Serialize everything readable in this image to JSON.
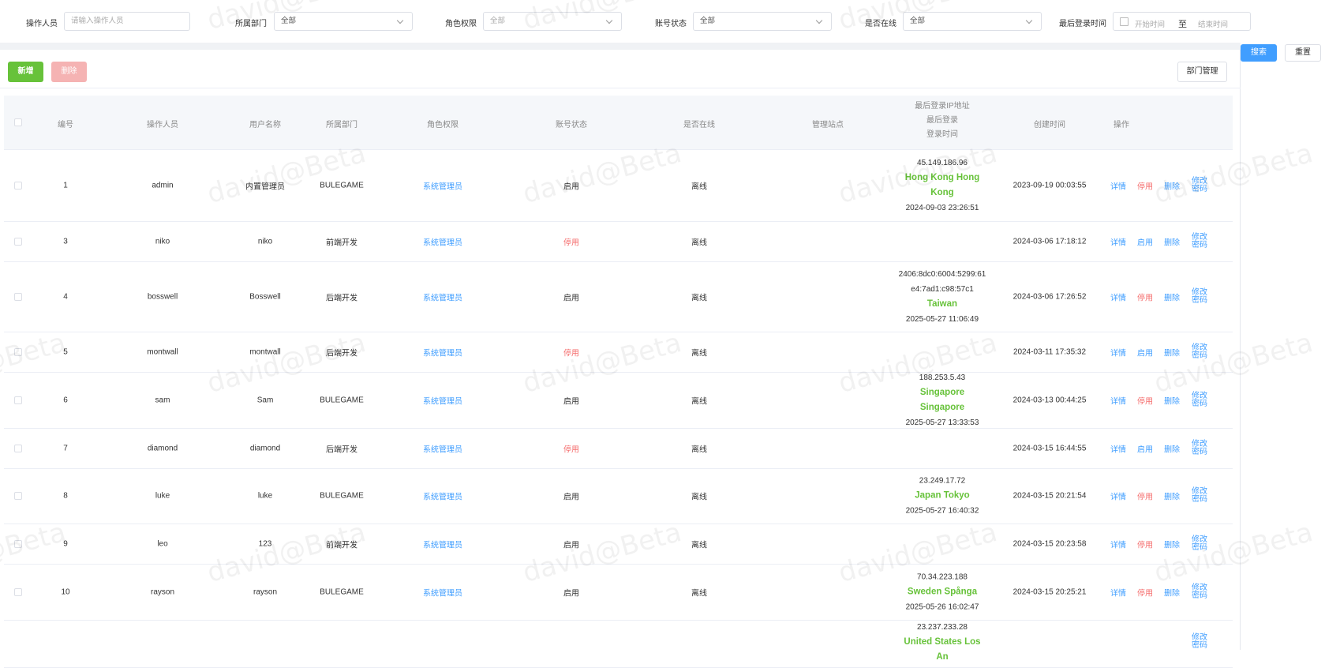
{
  "watermark": "david@Beta",
  "filters": {
    "operator": {
      "label": "操作人员",
      "placeholder": "请输入操作人员"
    },
    "department": {
      "label": "所属部门",
      "value": "全部"
    },
    "role": {
      "label": "角色权限",
      "value": "全部"
    },
    "status": {
      "label": "账号状态",
      "value": "全部"
    },
    "online": {
      "label": "是否在线",
      "value": "全部"
    },
    "last_login": {
      "label": "最后登录时间",
      "start_placeholder": "开始时间",
      "separator": "至",
      "end_placeholder": "结束时间"
    }
  },
  "buttons": {
    "search": "搜索",
    "reset": "重置",
    "add": "新增",
    "delete": "删除",
    "dept_manage": "部门管理"
  },
  "columns": {
    "id": "编号",
    "operator": "操作人员",
    "username": "用户名称",
    "department": "所属部门",
    "role": "角色权限",
    "status": "账号状态",
    "online": "是否在线",
    "site": "管理站点",
    "login_l1": "最后登录IP地址",
    "login_l2": "最后登录",
    "login_l3": "登录时间",
    "created": "创建时间",
    "actions": "操作"
  },
  "ops": {
    "detail": "详情",
    "stop": "停用",
    "start": "启用",
    "delete": "删除",
    "pwd": "修改密码"
  },
  "rows": [
    {
      "id": "1",
      "operator": "admin",
      "username": "内置管理员",
      "department": "BULEGAME",
      "role": "系统管理员",
      "status": "启用",
      "status_on": true,
      "online": "离线",
      "ip": "45.149.186.96",
      "location": "Hong Kong Hong Kong",
      "login_time": "2024-09-03 23:26:51",
      "created": "2023-09-19 00:03:55",
      "toggle": "停用"
    },
    {
      "id": "3",
      "operator": "niko",
      "username": "niko",
      "department": "前端开发",
      "role": "系统管理员",
      "status": "停用",
      "status_on": false,
      "online": "离线",
      "ip": "",
      "location": "",
      "login_time": "",
      "created": "2024-03-06 17:18:12",
      "toggle": "启用"
    },
    {
      "id": "4",
      "operator": "bosswell",
      "username": "Bosswell",
      "department": "后端开发",
      "role": "系统管理员",
      "status": "启用",
      "status_on": true,
      "online": "离线",
      "ip": "2406:8dc0:6004:5299:61e4:7ad1:c98:57c1",
      "ip_l1": "2406:8dc0:6004:5299:61",
      "ip_l2": "e4:7ad1:c98:57c1",
      "location": "Taiwan",
      "login_time": "2025-05-27 11:06:49",
      "created": "2024-03-06 17:26:52",
      "toggle": "停用"
    },
    {
      "id": "5",
      "operator": "montwall",
      "username": "montwall",
      "department": "后端开发",
      "role": "系统管理员",
      "status": "停用",
      "status_on": false,
      "online": "离线",
      "ip": "",
      "location": "",
      "login_time": "",
      "created": "2024-03-11 17:35:32",
      "toggle": "启用"
    },
    {
      "id": "6",
      "operator": "sam",
      "username": "Sam",
      "department": "BULEGAME",
      "role": "系统管理员",
      "status": "启用",
      "status_on": true,
      "online": "离线",
      "ip": "188.253.5.43",
      "location": "Singapore Singapore",
      "login_time": "2025-05-27 13:33:53",
      "created": "2024-03-13 00:44:25",
      "toggle": "停用"
    },
    {
      "id": "7",
      "operator": "diamond",
      "username": "diamond",
      "department": "后端开发",
      "role": "系统管理员",
      "status": "停用",
      "status_on": false,
      "online": "离线",
      "ip": "",
      "location": "",
      "login_time": "",
      "created": "2024-03-15 16:44:55",
      "toggle": "启用"
    },
    {
      "id": "8",
      "operator": "luke",
      "username": "luke",
      "department": "BULEGAME",
      "role": "系统管理员",
      "status": "启用",
      "status_on": true,
      "online": "离线",
      "ip": "23.249.17.72",
      "location": "Japan Tokyo",
      "login_time": "2025-05-27 16:40:32",
      "created": "2024-03-15 20:21:54",
      "toggle": "停用"
    },
    {
      "id": "9",
      "operator": "leo",
      "username": "123",
      "department": "前端开发",
      "role": "系统管理员",
      "status": "启用",
      "status_on": true,
      "online": "离线",
      "ip": "",
      "location": "",
      "login_time": "",
      "created": "2024-03-15 20:23:58",
      "toggle": "停用"
    },
    {
      "id": "10",
      "operator": "rayson",
      "username": "rayson",
      "department": "BULEGAME",
      "role": "系统管理员",
      "status": "启用",
      "status_on": true,
      "online": "离线",
      "ip": "70.34.223.188",
      "location": "Sweden Spånga",
      "login_time": "2025-05-26 16:02:47",
      "created": "2024-03-15 20:25:21",
      "toggle": "停用"
    },
    {
      "id": "",
      "operator": "",
      "username": "",
      "department": "",
      "role": "",
      "status": "",
      "status_on": true,
      "online": "",
      "ip": "23.237.233.28",
      "location": "United States Los An",
      "login_time": "",
      "created": "",
      "toggle": "",
      "partial": true
    }
  ]
}
